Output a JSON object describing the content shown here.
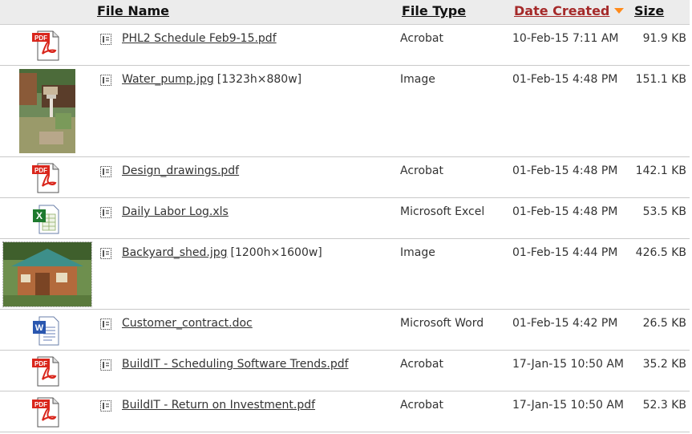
{
  "headers": {
    "file_name": "File Name",
    "file_type": "File Type",
    "date_created": "Date Created",
    "size": "Size"
  },
  "colors": {
    "sorted_header": "#a52a2a",
    "sort_arrow": "#ff8a1a",
    "header_bg": "#ececec"
  },
  "rows": [
    {
      "name": "PHL2 Schedule Feb9-15.pdf",
      "dims": "",
      "type": "Acrobat",
      "date": "10-Feb-15 7:11 AM",
      "size": "91.9 KB",
      "icon": "pdf-icon"
    },
    {
      "name": "Water_pump.jpg",
      "dims": "[1323h×880w]",
      "type": "Image",
      "date": "01-Feb-15 4:48 PM",
      "size": "151.1 KB",
      "icon": "water-pump-thumbnail"
    },
    {
      "name": "Design_drawings.pdf",
      "dims": "",
      "type": "Acrobat",
      "date": "01-Feb-15 4:48 PM",
      "size": "142.1 KB",
      "icon": "pdf-icon"
    },
    {
      "name": "Daily Labor Log.xls",
      "dims": "",
      "type": "Microsoft Excel",
      "date": "01-Feb-15 4:48 PM",
      "size": "53.5 KB",
      "icon": "excel-icon"
    },
    {
      "name": "Backyard_shed.jpg",
      "dims": "[1200h×1600w]",
      "type": "Image",
      "date": "01-Feb-15 4:44 PM",
      "size": "426.5 KB",
      "icon": "backyard-shed-thumbnail"
    },
    {
      "name": "Customer_contract.doc",
      "dims": "",
      "type": "Microsoft Word",
      "date": "01-Feb-15 4:42 PM",
      "size": "26.5 KB",
      "icon": "word-icon"
    },
    {
      "name": "BuildIT - Scheduling Software Trends.pdf",
      "dims": "",
      "type": "Acrobat",
      "date": "17-Jan-15 10:50 AM",
      "size": "35.2 KB",
      "icon": "pdf-icon"
    },
    {
      "name": "BuildIT - Return on Investment.pdf",
      "dims": "",
      "type": "Acrobat",
      "date": "17-Jan-15 10:50 AM",
      "size": "52.3 KB",
      "icon": "pdf-icon"
    }
  ]
}
